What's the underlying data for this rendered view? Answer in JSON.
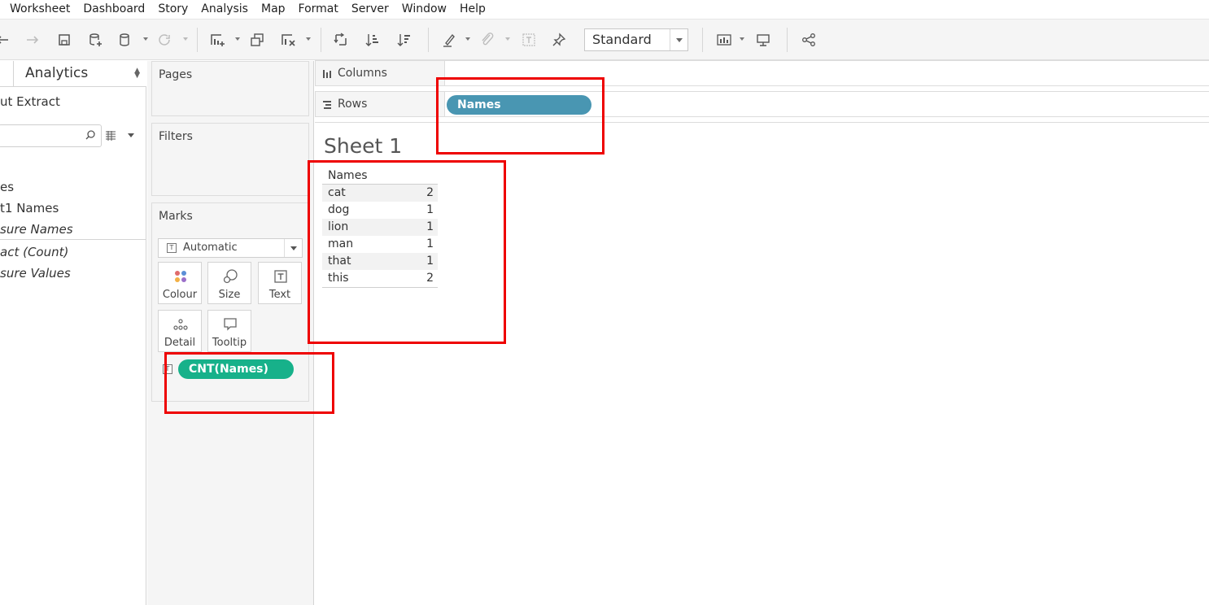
{
  "menu": [
    "Worksheet",
    "Dashboard",
    "Story",
    "Analysis",
    "Map",
    "Format",
    "Server",
    "Window",
    "Help"
  ],
  "toolbar": {
    "fit_value": "Standard"
  },
  "data_pane": {
    "tab_label": "Analytics",
    "datasource": "ut Extract",
    "fields": [
      {
        "label": "es",
        "italic": false
      },
      {
        "label": "t1 Names",
        "italic": false
      },
      {
        "label": "sure Names",
        "italic": true
      },
      {
        "label": "act (Count)",
        "italic": true
      },
      {
        "label": "sure Values",
        "italic": true
      }
    ]
  },
  "cards": {
    "pages": "Pages",
    "filters": "Filters",
    "marks": "Marks",
    "mark_type": "Automatic",
    "mark_type_icon": "T",
    "buttons": [
      "Colour",
      "Size",
      "Text",
      "Detail",
      "Tooltip"
    ],
    "text_pill": "CNT(Names)",
    "text_pill_icon": "T"
  },
  "shelves": {
    "columns_label": "Columns",
    "rows_label": "Rows",
    "rows_pill": "Names"
  },
  "sheet": {
    "title": "Sheet 1",
    "header": "Names",
    "rows": [
      {
        "name": "cat",
        "count": "2"
      },
      {
        "name": "dog",
        "count": "1"
      },
      {
        "name": "lion",
        "count": "1"
      },
      {
        "name": "man",
        "count": "1"
      },
      {
        "name": "that",
        "count": "1"
      },
      {
        "name": "this",
        "count": "2"
      }
    ]
  },
  "colors": {
    "dimension_pill": "#4996b2",
    "measure_pill": "#17b18a",
    "annotation": "#ee0000"
  }
}
